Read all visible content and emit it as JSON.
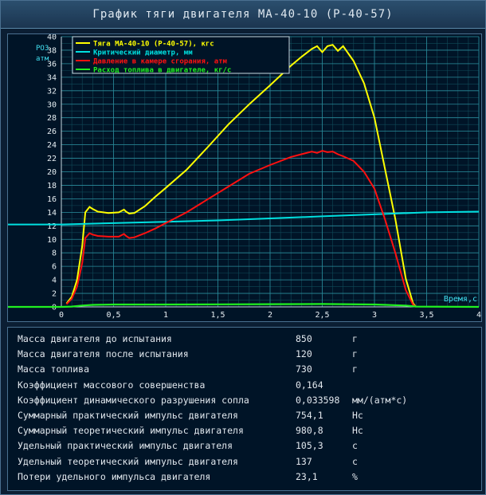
{
  "window": {
    "title": "График тяги двигателя МА-40-10 (Р-40-57)"
  },
  "chart_data": {
    "type": "line",
    "xlabel": "Время,с",
    "ylabel_lines": [
      "РО3",
      "атм"
    ],
    "xlim": [
      0,
      4
    ],
    "ylim": [
      0,
      40
    ],
    "x_ticks": [
      0,
      0.5,
      1,
      1.5,
      2,
      2.5,
      3,
      3.5,
      4
    ],
    "x_tick_labels": [
      "0",
      "0,5",
      "1",
      "1,5",
      "2",
      "2,5",
      "3",
      "3,5",
      "4"
    ],
    "y_ticks": [
      0,
      2,
      4,
      6,
      8,
      10,
      12,
      14,
      16,
      18,
      20,
      22,
      24,
      26,
      28,
      30,
      32,
      34,
      36,
      38,
      40
    ],
    "grid": true,
    "legend_position": "top-left",
    "series": [
      {
        "name": "Тяга МА-40-10 (Р-40-57), кгс",
        "color": "#ffff00",
        "x": [
          0.05,
          0.1,
          0.15,
          0.2,
          0.23,
          0.27,
          0.3,
          0.35,
          0.45,
          0.55,
          0.6,
          0.62,
          0.65,
          0.7,
          0.8,
          0.9,
          1.0,
          1.2,
          1.4,
          1.6,
          1.8,
          2.0,
          2.2,
          2.3,
          2.4,
          2.45,
          2.5,
          2.55,
          2.6,
          2.65,
          2.7,
          2.8,
          2.9,
          3.0,
          3.1,
          3.2,
          3.3,
          3.37,
          3.4
        ],
        "y": [
          0.5,
          1.5,
          4,
          9,
          14,
          14.8,
          14.5,
          14.1,
          13.9,
          14.0,
          14.4,
          14.1,
          13.8,
          13.9,
          14.9,
          16.3,
          17.6,
          20.3,
          23.6,
          27.0,
          30.0,
          32.8,
          35.7,
          37.0,
          38.2,
          38.6,
          37.7,
          38.6,
          38.8,
          37.9,
          38.6,
          36.4,
          33.1,
          28.0,
          20.5,
          13.0,
          4.2,
          0.5,
          0
        ],
        "y_scale": "left"
      },
      {
        "name": "Критический диаметр, мм",
        "color": "#00e0e0",
        "x": [
          -0.6,
          0,
          0.5,
          1,
          1.5,
          2,
          2.5,
          3,
          3.5,
          4
        ],
        "y": [
          12.2,
          12.2,
          12.4,
          12.6,
          12.8,
          13.1,
          13.4,
          13.7,
          14.0,
          14.1
        ],
        "y_scale": "left"
      },
      {
        "name": "Давление в камере сгорания, атм",
        "color": "#ff1010",
        "x": [
          0.05,
          0.1,
          0.15,
          0.2,
          0.23,
          0.27,
          0.3,
          0.35,
          0.45,
          0.55,
          0.6,
          0.62,
          0.65,
          0.7,
          0.8,
          0.9,
          1.0,
          1.2,
          1.4,
          1.6,
          1.8,
          2.0,
          2.2,
          2.3,
          2.4,
          2.45,
          2.5,
          2.55,
          2.6,
          2.65,
          2.7,
          2.8,
          2.9,
          3.0,
          3.1,
          3.2,
          3.3,
          3.37,
          3.4
        ],
        "y": [
          0.4,
          1.2,
          3,
          6.5,
          10.2,
          10.9,
          10.7,
          10.5,
          10.4,
          10.4,
          10.8,
          10.5,
          10.2,
          10.3,
          10.9,
          11.6,
          12.4,
          14.0,
          15.9,
          17.8,
          19.7,
          21.0,
          22.2,
          22.6,
          23.0,
          22.8,
          23.1,
          22.9,
          23.0,
          22.6,
          22.3,
          21.6,
          20.0,
          17.5,
          13.0,
          8.0,
          2.5,
          0.3,
          0
        ],
        "y_scale": "left"
      },
      {
        "name": "Расход топлива в двигателе, кг/с",
        "color": "#20f020",
        "x": [
          -0.6,
          0,
          0.1,
          0.2,
          0.3,
          0.5,
          1,
          1.5,
          2,
          2.5,
          3,
          3.3,
          3.4,
          4
        ],
        "y": [
          0,
          0,
          0.05,
          0.2,
          0.3,
          0.35,
          0.35,
          0.38,
          0.4,
          0.42,
          0.35,
          0.2,
          0.05,
          0
        ],
        "y_scale": "left"
      }
    ]
  },
  "stats": [
    {
      "label": "Масса двигателя до испытания",
      "value": "850",
      "unit": "г"
    },
    {
      "label": "Масса двигателя после испытания",
      "value": "120",
      "unit": "г"
    },
    {
      "label": "Масса топлива",
      "value": "730",
      "unit": "г"
    },
    {
      "label": "Коэффициент массового совершенства",
      "value": "0,164",
      "unit": ""
    },
    {
      "label": "Коэффициент динамического разрушения сопла",
      "value": "0,033598",
      "unit": "мм/(атм*с)"
    },
    {
      "label": "Суммарный практический импульс двигателя",
      "value": "754,1",
      "unit": "Нс"
    },
    {
      "label": "Суммарный теоретический импульс двигателя",
      "value": "980,8",
      "unit": "Нс"
    },
    {
      "label": "Удельный практический импульс двигателя",
      "value": "105,3",
      "unit": "с"
    },
    {
      "label": "Удельный теоретический импульс двигателя",
      "value": "137",
      "unit": "с"
    },
    {
      "label": "Потери удельного импульса двигателя",
      "value": "23,1",
      "unit": "%"
    }
  ]
}
